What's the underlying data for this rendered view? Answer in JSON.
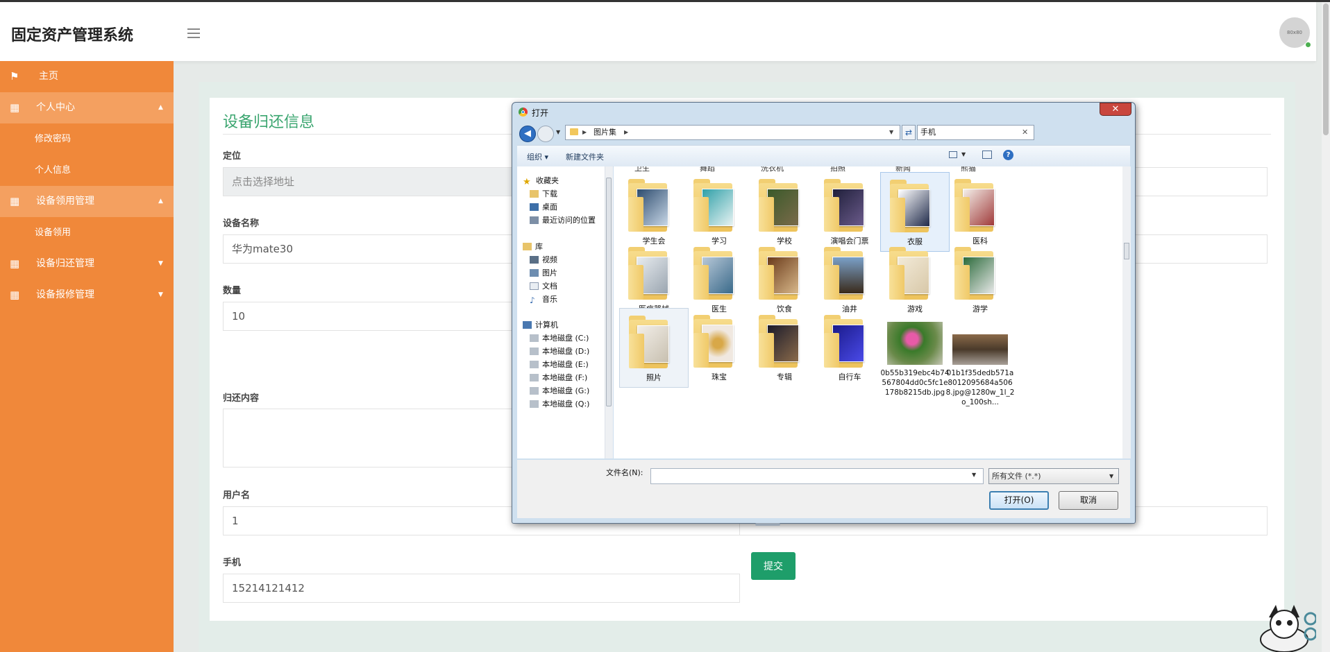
{
  "app": {
    "title": "固定资产管理系统",
    "avatar_text": "80x80"
  },
  "sidebar": {
    "items": [
      {
        "label": "主页"
      },
      {
        "label": "个人中心",
        "children": [
          "修改密码",
          "个人信息"
        ]
      },
      {
        "label": "设备领用管理",
        "children": [
          "设备领用"
        ]
      },
      {
        "label": "设备归还管理"
      },
      {
        "label": "设备报修管理"
      }
    ]
  },
  "form": {
    "title": "设备归还信息",
    "location_label": "定位",
    "location_placeholder": "点击选择地址",
    "device_name_label": "设备名称",
    "device_name_value": "华为mate30",
    "quantity_label": "数量",
    "quantity_value": "10",
    "return_content_label": "归还内容",
    "username_label": "用户名",
    "username_value": "1",
    "phone_label": "手机",
    "phone_value": "15214121412",
    "submit_label": "提交"
  },
  "dialog": {
    "title": "打开",
    "close_label": "✕",
    "breadcrumb": "图片集",
    "search_value": "手机",
    "toolbar": {
      "organize": "组织 ▾",
      "new_folder": "新建文件夹",
      "help": "?"
    },
    "nav_pane": {
      "favorites": {
        "label": "收藏夹",
        "items": [
          "下载",
          "桌面",
          "最近访问的位置"
        ]
      },
      "libraries": {
        "label": "库",
        "items": [
          "视频",
          "图片",
          "文档",
          "音乐"
        ]
      },
      "computer": {
        "label": "计算机",
        "items": [
          "本地磁盘 (C:)",
          "本地磁盘 (D:)",
          "本地磁盘 (E:)",
          "本地磁盘 (F:)",
          "本地磁盘 (G:)",
          "本地磁盘 (Q:)"
        ]
      }
    },
    "cut_row": [
      "卫生",
      "舞蹈",
      "洗衣机",
      "拍照",
      "新闻",
      "熊猫"
    ],
    "folders_row1": [
      "学生会",
      "学习",
      "学校",
      "演唱会门票",
      "衣服",
      "医科"
    ],
    "folders_row2": [
      "医疗器械",
      "医生",
      "饮食",
      "油井",
      "游戏",
      "游学"
    ],
    "folders_row3": [
      "照片",
      "珠宝",
      "专辑",
      "自行车"
    ],
    "files": [
      {
        "name": "0b55b319ebc4b74567804dd0c5fc1e178b8215db.jpg"
      },
      {
        "name": "01b1f35dedb571a8012095684a5068.jpg@1280w_1l_2o_100sh..."
      }
    ],
    "filename_label": "文件名(N):",
    "filetype_value": "所有文件 (*.*)",
    "open_label": "打开(O)",
    "cancel_label": "取消"
  }
}
